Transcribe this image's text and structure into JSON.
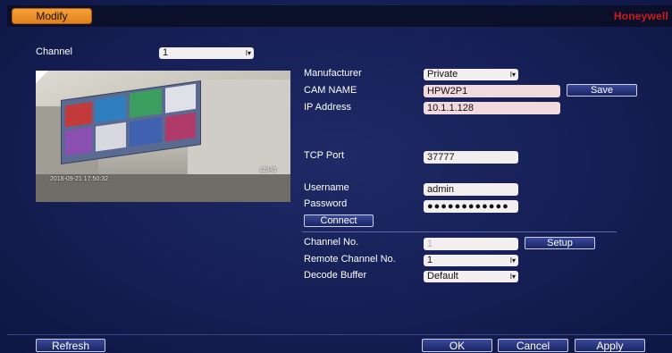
{
  "window": {
    "tab_label": "Modify",
    "brand": "Honeywell"
  },
  "channel": {
    "label": "Channel",
    "value": "1"
  },
  "preview": {
    "overlay_timestamp": "2018-09-21 17:50:32",
    "overlay_id": "12345"
  },
  "form": {
    "manufacturer": {
      "label": "Manufacturer",
      "value": "Private"
    },
    "cam_name": {
      "label": "CAM NAME",
      "value": "HPW2P1"
    },
    "save_label": "Save",
    "ip_address": {
      "label": "IP Address",
      "value": "10.1.1.128"
    },
    "tcp_port": {
      "label": "TCP Port",
      "value": "37777"
    },
    "username": {
      "label": "Username",
      "value": "admin"
    },
    "password": {
      "label": "Password",
      "value": "●●●●●●●●●●●●"
    },
    "connect_label": "Connect",
    "channel_no": {
      "label": "Channel No.",
      "value": "1"
    },
    "setup_label": "Setup",
    "remote_channel": {
      "label": "Remote Channel No.",
      "value": "1"
    },
    "decode_buffer": {
      "label": "Decode Buffer",
      "value": "Default"
    }
  },
  "footer": {
    "refresh_label": "Refresh",
    "ok_label": "OK",
    "cancel_label": "Cancel",
    "apply_label": "Apply"
  },
  "colors": {
    "accent": "#e88a22",
    "brand": "#d11a1a",
    "background": "#1a2360"
  },
  "icons": {
    "dropdown_arrow": "dropdown-arrow-icon"
  }
}
